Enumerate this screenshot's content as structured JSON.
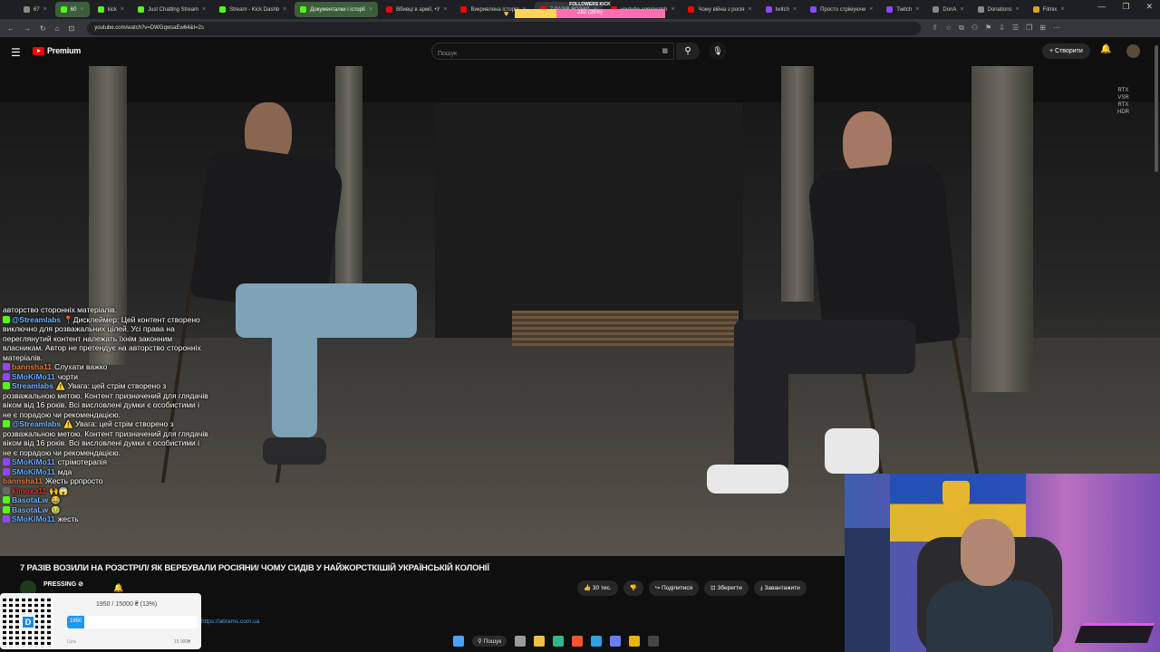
{
  "browser": {
    "tabs": [
      {
        "label": "67",
        "color": "#888888",
        "style": "plain"
      },
      {
        "label": "60",
        "color": "#53fc18",
        "style": "green"
      },
      {
        "label": "kick",
        "color": "#53fc18",
        "style": "plain"
      },
      {
        "label": "Just Chatting Stream",
        "color": "#53fc18",
        "style": "plain"
      },
      {
        "label": "Stream - Kick Dashb",
        "color": "#53fc18",
        "style": "plain"
      },
      {
        "label": "Документалки і історії",
        "color": "#53fc18",
        "style": "green"
      },
      {
        "label": "Вбивці в армії, •У",
        "color": "#ff0000",
        "style": "plain"
      },
      {
        "label": "Викривлена історія",
        "color": "#ff0000",
        "style": "plain"
      },
      {
        "label": "7 РАЗІВ ВОЗИЛ",
        "color": "#ff0000",
        "style": "active"
      },
      {
        "label": "youtube.com/watch",
        "color": "#ff0000",
        "style": "plain"
      },
      {
        "label": "Чому війна з росія",
        "color": "#ff0000",
        "style": "plain"
      },
      {
        "label": "twitch",
        "color": "#9146ff",
        "style": "plain"
      },
      {
        "label": "Просто стрімуючи",
        "color": "#9146ff",
        "style": "plain"
      },
      {
        "label": "Twitch",
        "color": "#9146ff",
        "style": "plain"
      },
      {
        "label": "DonA",
        "color": "#888888",
        "style": "plain"
      },
      {
        "label": "Donations",
        "color": "#888888",
        "style": "plain"
      },
      {
        "label": "Filmix",
        "color": "#e0a020",
        "style": "plain"
      }
    ],
    "window_controls": [
      "—",
      "❐",
      "✕"
    ],
    "url": "youtube.com/watch?v=DWGqwsaEw64&t=2s",
    "nav_icons": [
      "←",
      "→",
      "↻",
      "⌂",
      "⊡"
    ],
    "ext_icons": [
      "⇪",
      "☆",
      "⧉",
      "⚇",
      "⚑",
      "⇩",
      "☰",
      "❐",
      "⊞",
      "⋯"
    ]
  },
  "followers_kick": {
    "label": "FOLLOWERS KICK",
    "progress_text": "282 (28%)",
    "progress_fraction": 0.28,
    "min": "0",
    "max": "1000",
    "sub": "RIGHT NOW",
    "heart": "♥"
  },
  "youtube": {
    "logo_text": "Premium",
    "search_placeholder": "Пошук",
    "create_label": "+ Створити",
    "hamburger": "☰",
    "search_icon": "⚲",
    "mic_icon": "🎙",
    "bell_icon": "🔔",
    "keyboard_icon": "▦"
  },
  "video": {
    "rtx_text": [
      "RTX",
      "VSR",
      "RTX",
      "HDR"
    ],
    "title": "7 РАЗІВ ВОЗИЛИ НА РОЗСТРІЛ/ ЯК ВЕРБУВАЛИ РОСІЯНИ/ ЧОМУ СИДІВ У НАЙЖОРСТКІШІЙ УКРАЇНСЬКІЙ КОЛОНІЇ",
    "channel": "PRESSING ⊘",
    "description_link": "https://abrams.com.ua"
  },
  "actions": [
    {
      "label": "👍 30 тис.",
      "name": "like-button"
    },
    {
      "label": "👎",
      "name": "dislike-button"
    },
    {
      "label": "↪ Поділитися",
      "name": "share-button"
    },
    {
      "label": "⊡ Зберегти",
      "name": "save-button"
    },
    {
      "label": "⤓ Завантажити",
      "name": "download-button"
    }
  ],
  "chat": [
    {
      "badge": "",
      "badge_color": "",
      "user": "",
      "user_color": "#ffffff",
      "text": "авторство сторонніх матеріалів."
    },
    {
      "badge": "K",
      "badge_color": "#53fc18",
      "user": "@Streamlabs",
      "user_color": "#6fb4ff",
      "text": "📍Дисклеймер: Цей контент створено виключно для розважальних цілей. Усі права на переглянутий контент належать їхнім законним власникам. Автор не претендує на авторство сторонніх матеріалів."
    },
    {
      "badge": "T",
      "badge_color": "#9146ff",
      "user": "bannsha11",
      "user_color": "#e07a3a",
      "text": "Слухати важко"
    },
    {
      "badge": "T",
      "badge_color": "#9146ff",
      "user": "SMoKiMo11",
      "user_color": "#5fa8ff",
      "text": "чорти"
    },
    {
      "badge": "K",
      "badge_color": "#53fc18",
      "user": "Streamlabs",
      "user_color": "#6fb4ff",
      "text": "⚠️ Увага: цей стрім створено з розважальною метою. Контент призначений для глядачів віком від 16 років. Всі висловлені думки є особистими і не є порадою чи рекомендацією."
    },
    {
      "badge": "K",
      "badge_color": "#53fc18",
      "user": "@Streamlabs",
      "user_color": "#6fb4ff",
      "text": "⚠️ Увага: цей стрім створено з розважальною метою. Контент призначений для глядачів віком від 16 років. Всі висловлені думки є особистими і не є порадою чи рекомендацією."
    },
    {
      "badge": "T",
      "badge_color": "#9146ff",
      "user": "SMoKiMo11",
      "user_color": "#5fa8ff",
      "text": "стрімотерапія"
    },
    {
      "badge": "T",
      "badge_color": "#9146ff",
      "user": "SMoKiMo11",
      "user_color": "#5fa8ff",
      "text": "мда"
    },
    {
      "badge": "",
      "badge_color": "",
      "user": "bannsha11",
      "user_color": "#e07a3a",
      "text": "Жесть ррпросто"
    },
    {
      "badge": "◂",
      "badge_color": "#666666",
      "user": "kimoxa11",
      "user_color": "#e03030",
      "text": "🙌😱"
    },
    {
      "badge": "K",
      "badge_color": "#53fc18",
      "user": "BasotaLw",
      "user_color": "#6fb4ff",
      "text": "😂"
    },
    {
      "badge": "K",
      "badge_color": "#53fc18",
      "user": "BasotaLw",
      "user_color": "#6fb4ff",
      "text": "🤢"
    },
    {
      "badge": "T",
      "badge_color": "#9146ff",
      "user": "SMoKiMo11",
      "user_color": "#5fa8ff",
      "text": "жесть"
    }
  ],
  "donation": {
    "title": "1950 / 15000 ₴ (13%)",
    "bar_text": "1950",
    "fraction": 0.13,
    "goal_left": "Ціль",
    "goal_right": "15 000₴",
    "qr_logo": "D"
  },
  "taskbar": {
    "search_label": "⚲ Пошук",
    "icons": [
      {
        "name": "windows-start-icon",
        "color": "#4aa3ff"
      },
      {
        "name": "task-view-icon",
        "color": "#9a9a9a"
      },
      {
        "name": "file-explorer-icon",
        "color": "#f0c040"
      },
      {
        "name": "edge-icon",
        "color": "#2fb88a"
      },
      {
        "name": "brave-icon",
        "color": "#fb542b"
      },
      {
        "name": "telegram-icon",
        "color": "#2aa3e0"
      },
      {
        "name": "store-icon",
        "color": "#6a7dff"
      },
      {
        "name": "chrome-icon",
        "color": "#e8b400"
      },
      {
        "name": "obs-icon",
        "color": "#444444"
      }
    ]
  }
}
